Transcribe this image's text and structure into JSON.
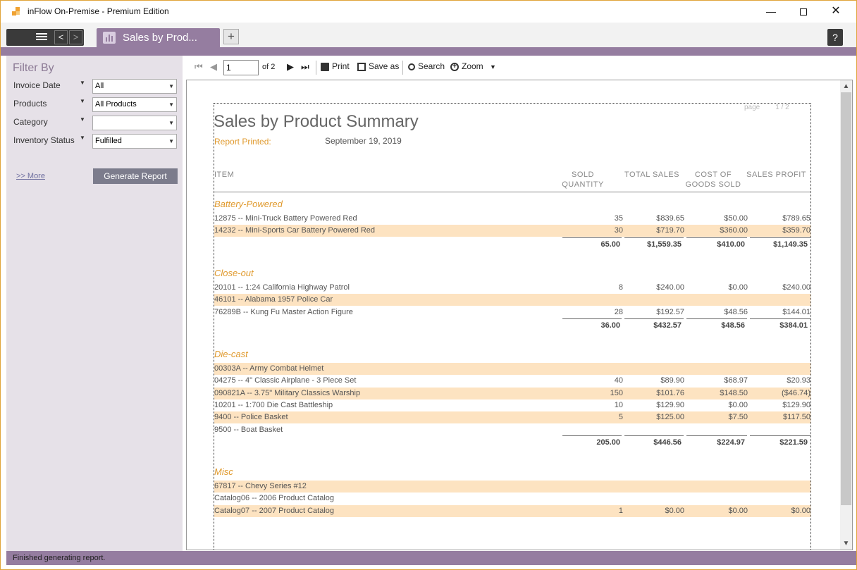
{
  "window": {
    "title": "inFlow On-Premise - Premium Edition",
    "minimize": "—",
    "close": "✕"
  },
  "tabs": {
    "active_tab": "Sales by Prod...",
    "add_tab": "+",
    "help": "?",
    "back": "<",
    "forward": ">"
  },
  "sidebar": {
    "title": "Filter By",
    "filters": [
      {
        "label": "Invoice Date",
        "value": "All"
      },
      {
        "label": "Products",
        "value": "All Products"
      },
      {
        "label": "Category",
        "value": ""
      },
      {
        "label": "Inventory Status",
        "value": "Fulfilled"
      }
    ],
    "more_link": ">> More",
    "generate_button": "Generate Report"
  },
  "toolbar": {
    "page_value": "1",
    "of_label": "of  2",
    "print": "Print",
    "save_as": "Save as",
    "search": "Search",
    "zoom": "Zoom"
  },
  "report": {
    "page_label": "page",
    "page_value": "1 / 2",
    "title": "Sales by Product Summary",
    "printed_label": "Report Printed:",
    "printed_date": "September 19, 2019",
    "headers": {
      "item": "ITEM",
      "sold_qty_1": "SOLD",
      "sold_qty_2": "QUANTITY",
      "total_sales": "TOTAL SALES",
      "cost_1": "COST OF",
      "cost_2": "GOODS SOLD",
      "profit": "SALES PROFIT"
    },
    "categories": [
      {
        "name": "Battery-Powered",
        "rows": [
          {
            "item": "12875 -- Mini-Truck Battery Powered Red",
            "qty": "35",
            "total": "$839.65",
            "cost": "$50.00",
            "profit": "$789.65"
          },
          {
            "item": "14232 -- Mini-Sports Car Battery Powered Red",
            "qty": "30",
            "total": "$719.70",
            "cost": "$360.00",
            "profit": "$359.70"
          }
        ],
        "totals": {
          "qty": "65.00",
          "total": "$1,559.35",
          "cost": "$410.00",
          "profit": "$1,149.35"
        }
      },
      {
        "name": "Close-out",
        "rows": [
          {
            "item": "20101 -- 1:24 California Highway Patrol",
            "qty": "8",
            "total": "$240.00",
            "cost": "$0.00",
            "profit": "$240.00"
          },
          {
            "item": "46101 -- Alabama 1957 Police Car",
            "qty": "",
            "total": "",
            "cost": "",
            "profit": ""
          },
          {
            "item": "76289B -- Kung Fu Master Action Figure",
            "qty": "28",
            "total": "$192.57",
            "cost": "$48.56",
            "profit": "$144.01"
          }
        ],
        "totals": {
          "qty": "36.00",
          "total": "$432.57",
          "cost": "$48.56",
          "profit": "$384.01"
        }
      },
      {
        "name": "Die-cast",
        "rows": [
          {
            "item": "00303A -- Army Combat Helmet",
            "qty": "",
            "total": "",
            "cost": "",
            "profit": ""
          },
          {
            "item": "04275 -- 4\" Classic Airplane - 3 Piece Set",
            "qty": "40",
            "total": "$89.90",
            "cost": "$68.97",
            "profit": "$20.93"
          },
          {
            "item": "090821A -- 3.75\" Military Classics Warship",
            "qty": "150",
            "total": "$101.76",
            "cost": "$148.50",
            "profit": "($46.74)"
          },
          {
            "item": "10201 -- 1:700 Die Cast Battleship",
            "qty": "10",
            "total": "$129.90",
            "cost": "$0.00",
            "profit": "$129.90"
          },
          {
            "item": "9400 -- Police Basket",
            "qty": "5",
            "total": "$125.00",
            "cost": "$7.50",
            "profit": "$117.50"
          },
          {
            "item": "9500 -- Boat Basket",
            "qty": "",
            "total": "",
            "cost": "",
            "profit": ""
          }
        ],
        "totals": {
          "qty": "205.00",
          "total": "$446.56",
          "cost": "$224.97",
          "profit": "$221.59"
        }
      },
      {
        "name": "Misc",
        "rows": [
          {
            "item": "67817 -- Chevy Series #12",
            "qty": "",
            "total": "",
            "cost": "",
            "profit": ""
          },
          {
            "item": "Catalog06 -- 2006 Product Catalog",
            "qty": "",
            "total": "",
            "cost": "",
            "profit": ""
          },
          {
            "item": "Catalog07 -- 2007 Product Catalog",
            "qty": "1",
            "total": "$0.00",
            "cost": "$0.00",
            "profit": "$0.00"
          }
        ]
      }
    ]
  },
  "status": {
    "text": "Finished generating report."
  },
  "colors": {
    "accent": "#957da0",
    "highlight_row": "#fde3c1",
    "category_title": "#e09a2e"
  }
}
